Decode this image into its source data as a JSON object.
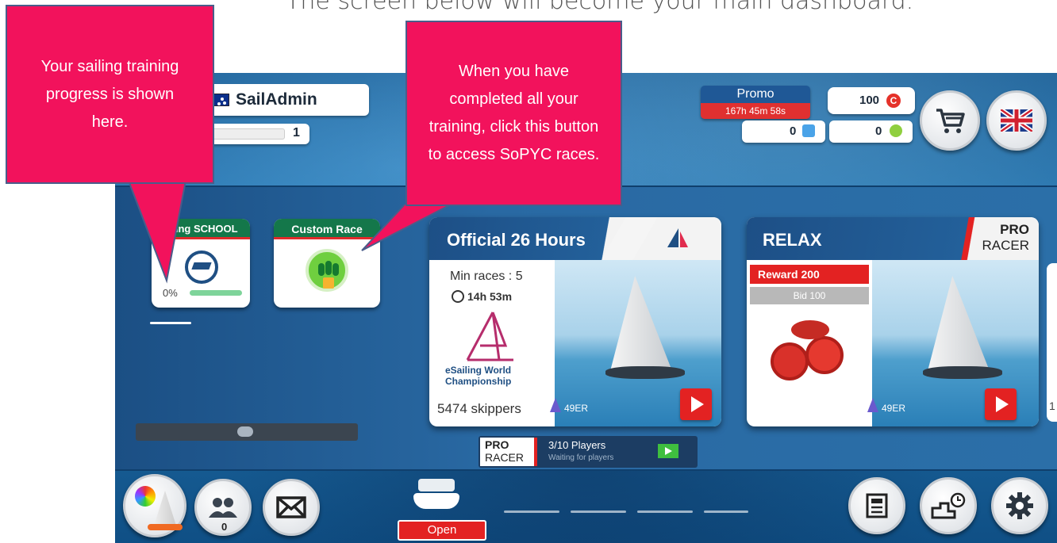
{
  "caption": "The screen below will become your main dashboard.",
  "callouts": {
    "training": "Your sailing training progress is shown here.",
    "sopyc": "When you have completed all your training, click this button to access SoPYC races."
  },
  "profile": {
    "username": "SailAdmin",
    "level": "1"
  },
  "promo": {
    "label": "Promo",
    "timer": "167h 45m 58s"
  },
  "currency": {
    "coins": "100",
    "gems": "0",
    "tokens": "0"
  },
  "sailing_school": {
    "label": "ailing SCHOOL",
    "progress_text": "0%",
    "progress": 0
  },
  "custom_race": {
    "label": "Custom Race"
  },
  "official_race": {
    "title": "Official 26 Hours",
    "min_races": "Min races : 5",
    "time": "14h 53m",
    "logo_line1": "eSailing World",
    "logo_line2": "Championship",
    "skippers": "5474 skippers",
    "boat": "49ER"
  },
  "relax_race": {
    "title": "RELAX",
    "badge_top": "PRO",
    "badge_bottom": "RACER",
    "reward": "Reward 200",
    "bid": "Bid 100",
    "boat": "49ER",
    "partial_count": "1"
  },
  "pro_racer_bar": {
    "badge_top": "PRO",
    "badge_bottom": "RACER",
    "players": "3/10 Players",
    "status": "Waiting for players"
  },
  "friends_count": "0",
  "open_label": "Open",
  "colors": {
    "accent_red": "#e32222",
    "callout_pink": "#f2125c",
    "school_green": "#14774a",
    "navy": "#1d4f86"
  }
}
